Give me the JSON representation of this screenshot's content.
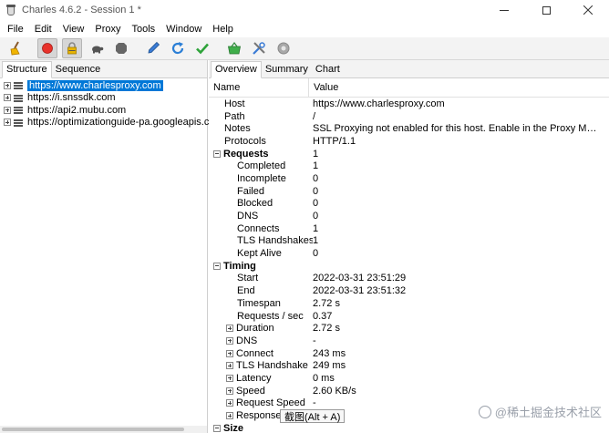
{
  "window": {
    "title": "Charles 4.6.2 - Session 1 *"
  },
  "menu": [
    "File",
    "Edit",
    "View",
    "Proxy",
    "Tools",
    "Window",
    "Help"
  ],
  "toolbar": {
    "icons": [
      "broom-icon",
      "record-icon",
      "ssl-proxying-icon",
      "throttle-icon",
      "breakpoints-icon",
      "compose-icon",
      "repeat-icon",
      "validate-icon",
      "shopping-basket-icon",
      "tools-icon",
      "settings-icon"
    ]
  },
  "left_tabs": {
    "structure": "Structure",
    "sequence": "Sequence"
  },
  "hosts": [
    {
      "label": "https://www.charlesproxy.com",
      "selected": true
    },
    {
      "label": "https://i.snssdk.com"
    },
    {
      "label": "https://api2.mubu.com"
    },
    {
      "label": "https://optimizationguide-pa.googleapis.co"
    }
  ],
  "right_tabs": {
    "overview": "Overview",
    "summary": "Summary",
    "chart": "Chart"
  },
  "table_header": {
    "name": "Name",
    "value": "Value"
  },
  "rows": [
    {
      "kind": "item",
      "indent": 1,
      "name": "Host",
      "value": "https://www.charlesproxy.com"
    },
    {
      "kind": "item",
      "indent": 1,
      "name": "Path",
      "value": "/"
    },
    {
      "kind": "item",
      "indent": 1,
      "name": "Notes",
      "value": "SSL Proxying not enabled for this host. Enable in the Proxy Menu, SSL P..."
    },
    {
      "kind": "item",
      "indent": 1,
      "name": "Protocols",
      "value": "HTTP/1.1"
    },
    {
      "kind": "section",
      "name": "Requests",
      "value": "1"
    },
    {
      "kind": "item",
      "indent": 2,
      "name": "Completed",
      "value": "1"
    },
    {
      "kind": "item",
      "indent": 2,
      "name": "Incomplete",
      "value": "0"
    },
    {
      "kind": "item",
      "indent": 2,
      "name": "Failed",
      "value": "0"
    },
    {
      "kind": "item",
      "indent": 2,
      "name": "Blocked",
      "value": "0"
    },
    {
      "kind": "item",
      "indent": 2,
      "name": "DNS",
      "value": "0"
    },
    {
      "kind": "item",
      "indent": 2,
      "name": "Connects",
      "value": "1"
    },
    {
      "kind": "item",
      "indent": 2,
      "name": "TLS Handshakes",
      "value": "1"
    },
    {
      "kind": "item",
      "indent": 2,
      "name": "Kept Alive",
      "value": "0"
    },
    {
      "kind": "section",
      "name": "Timing",
      "value": ""
    },
    {
      "kind": "item",
      "indent": 2,
      "name": "Start",
      "value": "2022-03-31 23:51:29"
    },
    {
      "kind": "item",
      "indent": 2,
      "name": "End",
      "value": "2022-03-31 23:51:32"
    },
    {
      "kind": "item",
      "indent": 2,
      "name": "Timespan",
      "value": "2.72 s"
    },
    {
      "kind": "item",
      "indent": 2,
      "name": "Requests / sec",
      "value": "0.37"
    },
    {
      "kind": "expandable",
      "name": "Duration",
      "value": "2.72 s"
    },
    {
      "kind": "expandable",
      "name": "DNS",
      "value": "-"
    },
    {
      "kind": "expandable",
      "name": "Connect",
      "value": "243 ms"
    },
    {
      "kind": "expandable",
      "name": "TLS Handshake",
      "value": "249 ms"
    },
    {
      "kind": "expandable",
      "name": "Latency",
      "value": "0 ms"
    },
    {
      "kind": "expandable",
      "name": "Speed",
      "value": "2.60 KB/s"
    },
    {
      "kind": "expandable",
      "name": "Request Speed",
      "value": "-"
    },
    {
      "kind": "expandable",
      "name": "Response Spe",
      "value": ""
    },
    {
      "kind": "section",
      "name": "Size",
      "value": ""
    }
  ],
  "tooltip": "截图(Alt + A)",
  "watermark": "@稀土掘金技术社区"
}
